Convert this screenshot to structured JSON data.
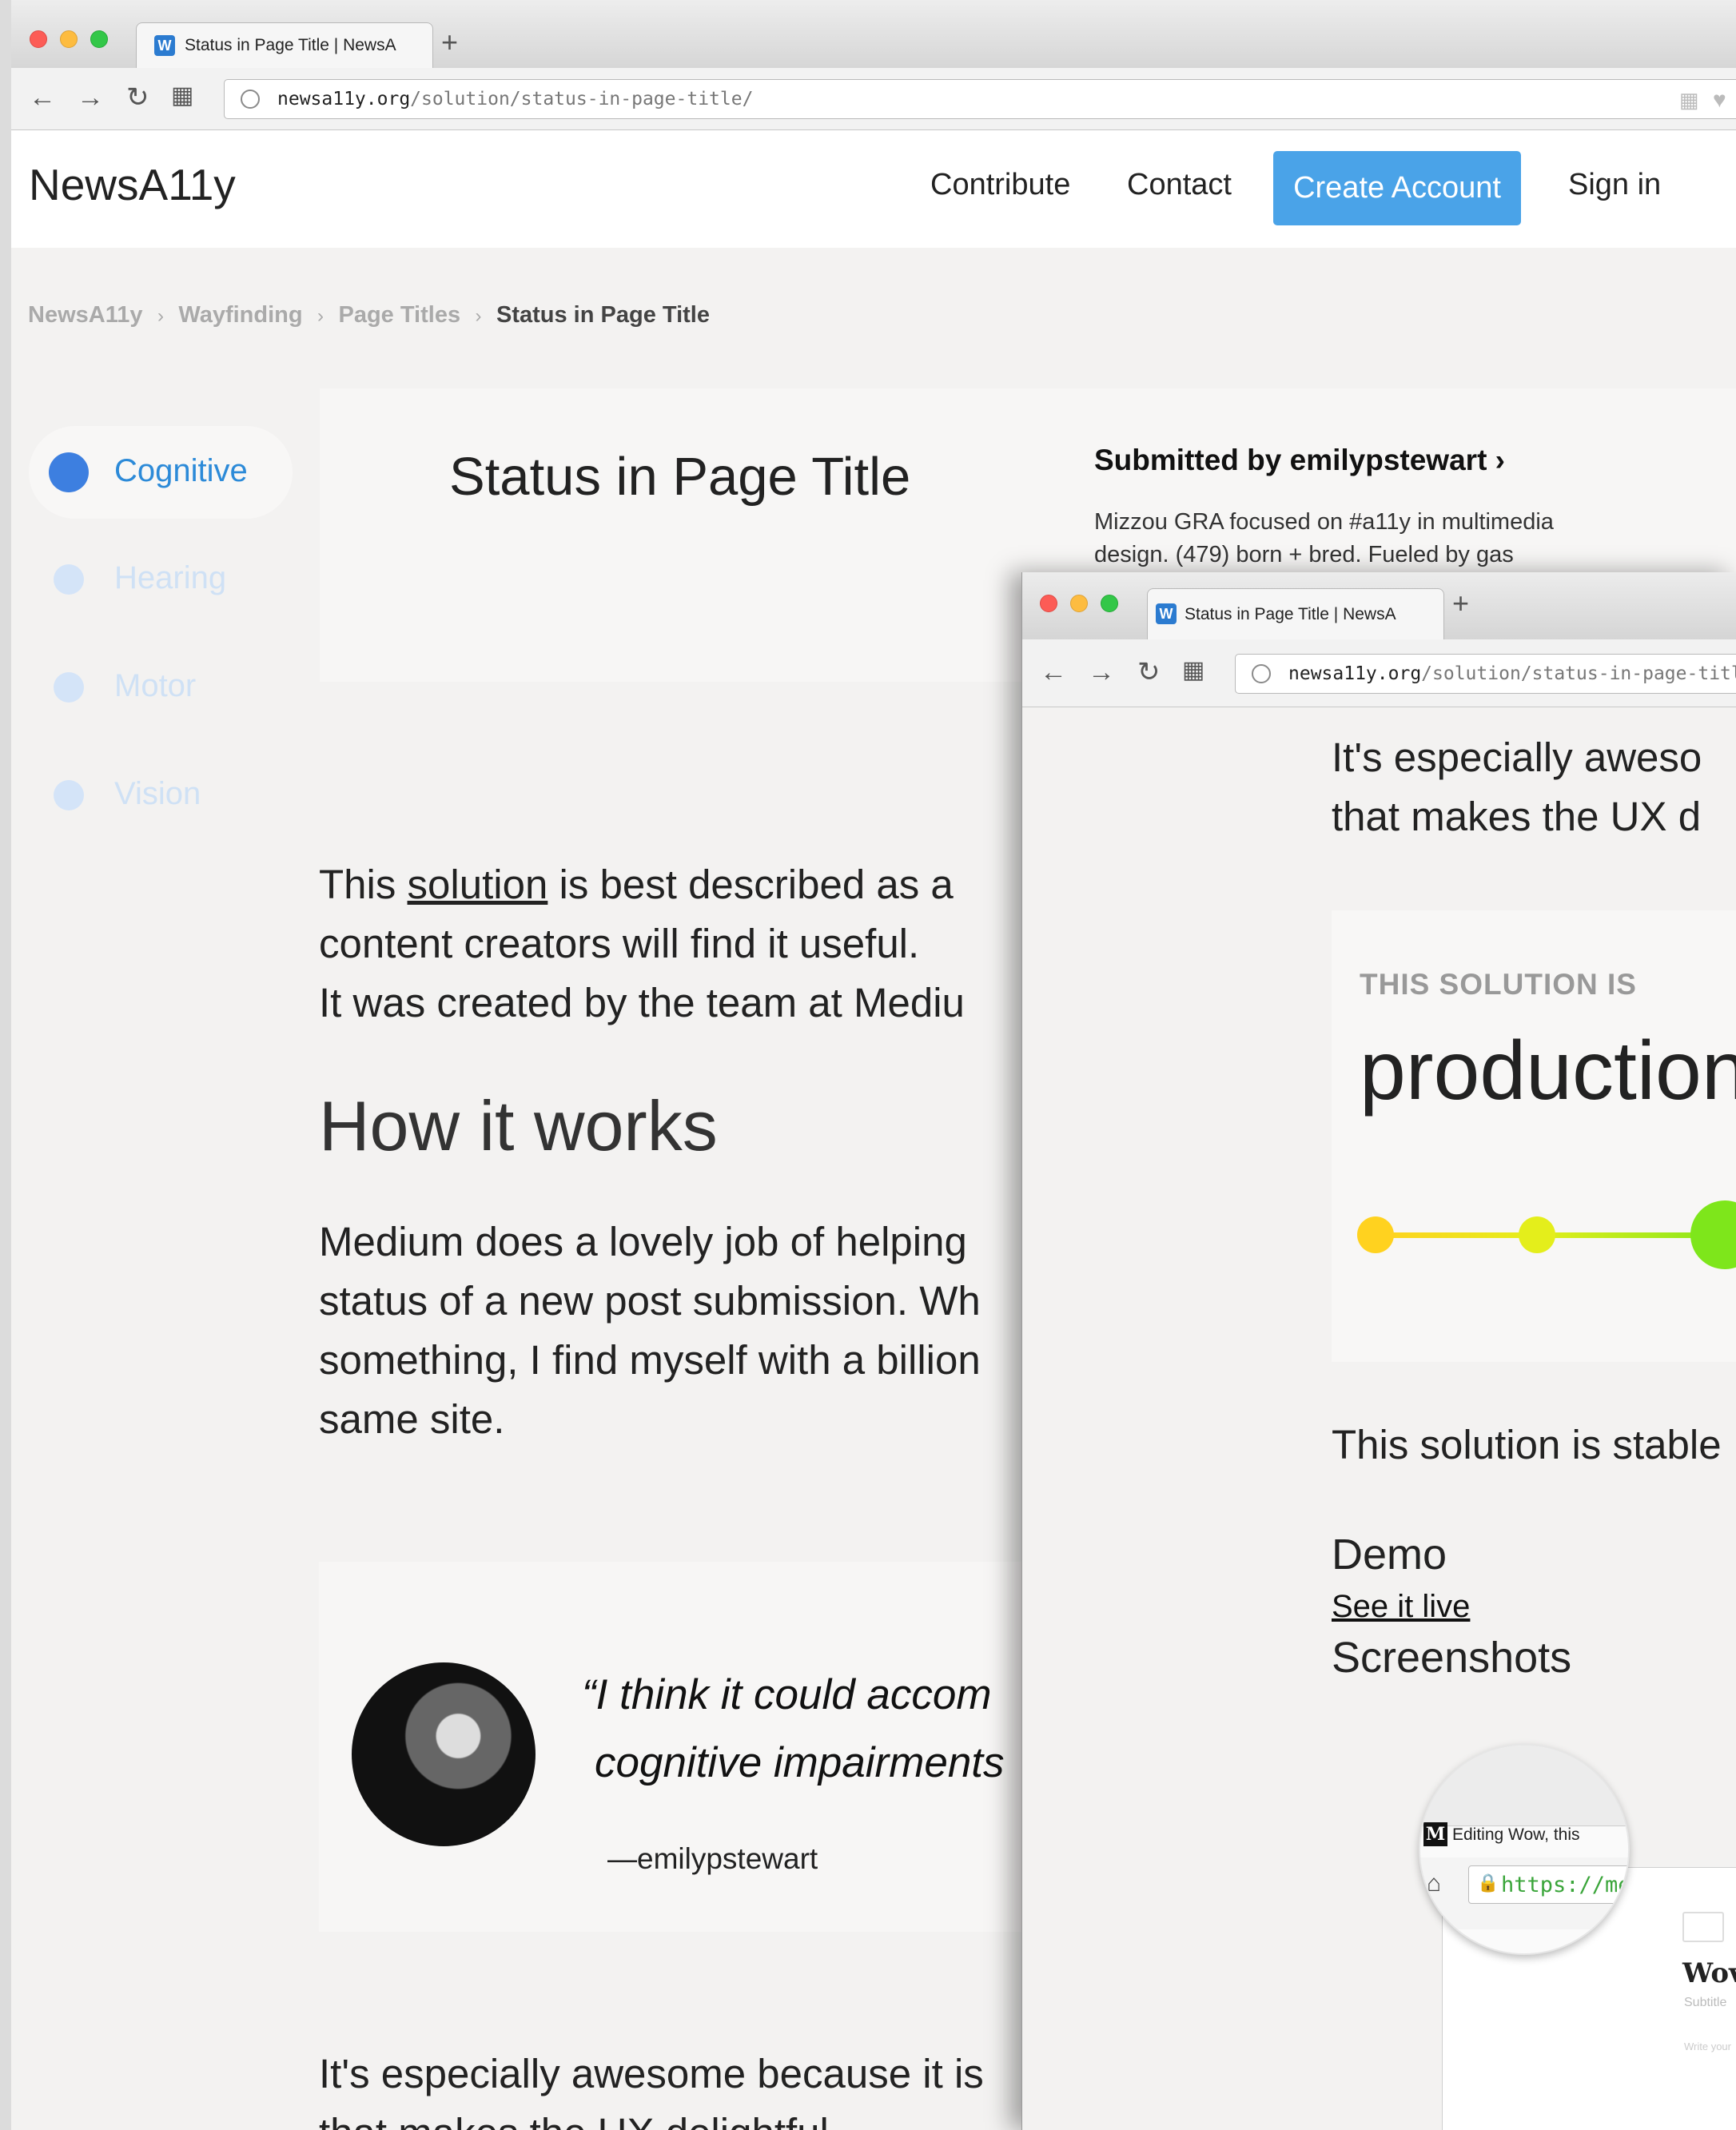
{
  "browser": {
    "tab_title": "Status in Page Title | NewsA",
    "new_tab_icon": "plus-icon",
    "url_host": "newsa11y.org",
    "url_path": "/solution/status-in-page-title/"
  },
  "site": {
    "brand": "NewsA11y",
    "nav": {
      "contribute": "Contribute",
      "contact": "Contact",
      "create_account": "Create Account",
      "sign_in": "Sign in"
    },
    "accent_color": "#4aa3e8",
    "breadcrumb": [
      "NewsA11y",
      "Wayfinding",
      "Page Titles",
      "Status in Page Title"
    ],
    "breadcrumb_separator": "›",
    "sidebar": [
      {
        "label": "Cognitive",
        "active": true
      },
      {
        "label": "Hearing",
        "active": false
      },
      {
        "label": "Motor",
        "active": false
      },
      {
        "label": "Vision",
        "active": false
      }
    ],
    "hero": {
      "title": "Status in Page Title",
      "submitted_by": "Submitted by emilypstewart ›",
      "bio_line1": "Mizzou GRA focused on #a11y in multimedia",
      "bio_line2": "design. (479) born + bred. Fueled by gas"
    },
    "intro": {
      "line1_prefix": "This ",
      "line1_link": "solution",
      "line1_suffix": " is best described as a",
      "line2": "content creators will find it useful.",
      "line3": "It was created by the team at Mediu"
    },
    "how_heading": "How it works",
    "how_lines": [
      "Medium does a lovely job of helping",
      "status of a new post submission. Wh",
      "something, I find myself with a billion",
      "same site."
    ],
    "quote": {
      "line1": "“I think it could accom",
      "line2": "cognitive impairments",
      "attribution": "—emilypstewart"
    },
    "bottom_lines": [
      "It's especially awesome because it is",
      "that makes the UX delightful"
    ]
  },
  "overlay": {
    "tab_title": "Status in Page Title | NewsA",
    "url_host": "newsa11y.org",
    "url_path": "/solution/status-in-page-title",
    "text_line1": "It's especially aweso",
    "text_line2": "that makes the UX d",
    "status_kicker": "THIS SOLUTION IS",
    "status_word": "production",
    "status_colors": [
      "#ffd21f",
      "#e4ee1b",
      "#7ee61b"
    ],
    "stable_line": "This solution is stable",
    "demo_heading": "Demo",
    "demo_link": "See it live",
    "screenshots_heading": "Screenshots",
    "screenshot": {
      "medium_logo": "M",
      "tab_text": "Editing Wow, this",
      "url_text": "https://me",
      "heading": "Wov",
      "subtitle": "Subtitle",
      "placeholder": "Write your"
    }
  }
}
